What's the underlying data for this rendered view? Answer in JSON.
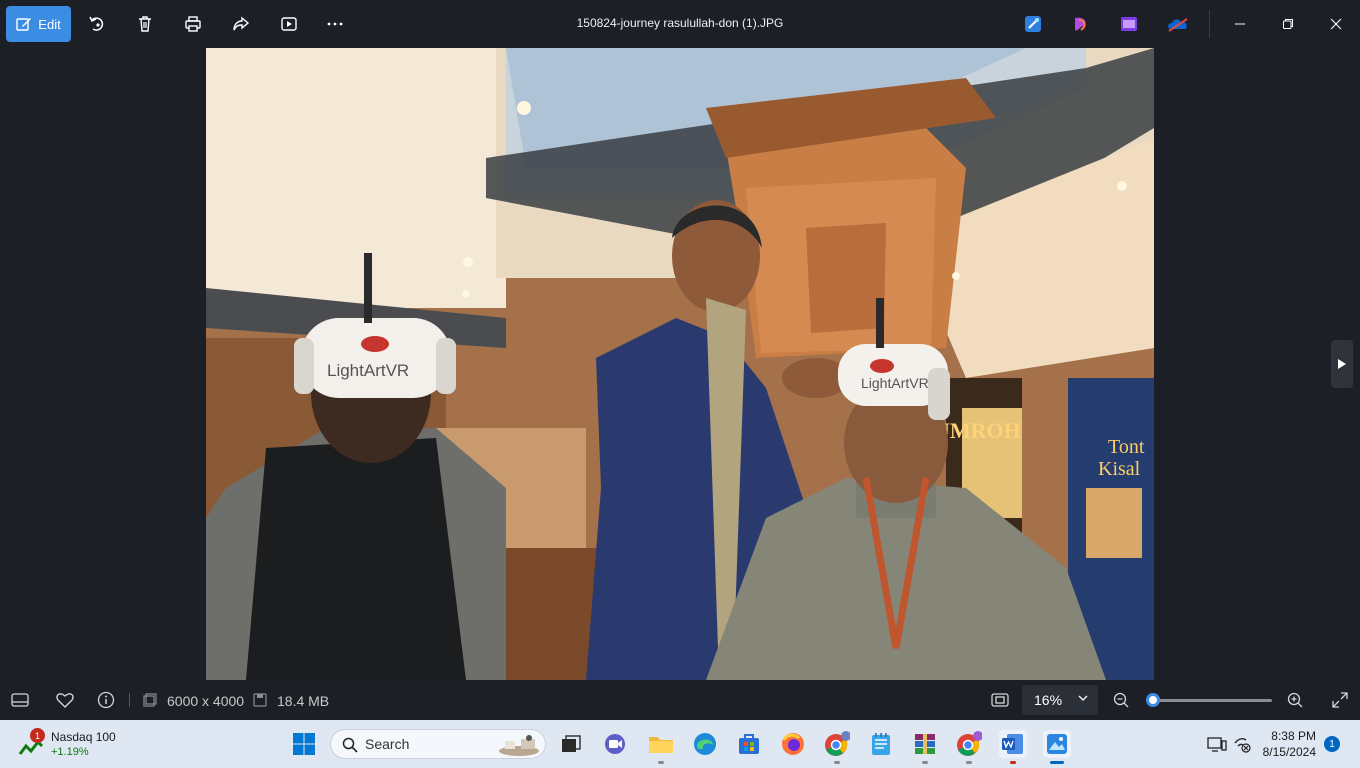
{
  "toolbar": {
    "edit_label": "Edit",
    "file_title": "150824-journey rasulullah-don (1).JPG",
    "icons": [
      "edit-icon",
      "rotate-icon",
      "delete-icon",
      "print-icon",
      "share-icon",
      "slideshow-icon",
      "more-icon"
    ],
    "apps": [
      "designer-icon",
      "clipchamp-icon",
      "video-icon",
      "onedrive-icon"
    ]
  },
  "photo": {
    "headset_brand": "LightArtVR",
    "poster_left": "UMROH",
    "poster_right_line1": "Tont",
    "poster_right_line2": "Kisal"
  },
  "status": {
    "dimensions": "6000 x 4000",
    "file_size": "18.4 MB",
    "zoom": "16%",
    "zoom_fraction": 0.02
  },
  "taskbar": {
    "widget_name": "Nasdaq 100",
    "widget_change": "+1.19%",
    "widget_badge": "1",
    "search_placeholder": "Search",
    "time": "8:38 PM",
    "date": "8/15/2024",
    "notifications": "1"
  },
  "colors": {
    "accent": "#3b8de4",
    "background": "#1c1f26",
    "taskbar": "#dfe7f2"
  }
}
